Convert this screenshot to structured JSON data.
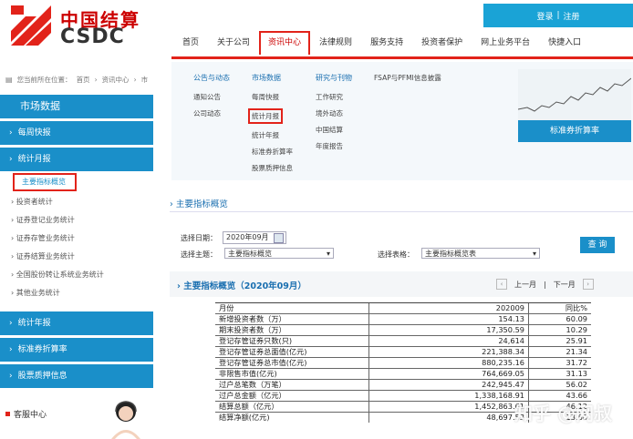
{
  "brand": {
    "name_cn": "中国结算",
    "name_en": "CSDC",
    "accent": "#e2231a",
    "blue": "#1a8fc9"
  },
  "header": {
    "login": "登录",
    "sep": "|",
    "register": "注册"
  },
  "topnav": [
    "首页",
    "关于公司",
    "资讯中心",
    "法律规则",
    "服务支持",
    "投资者保护",
    "网上业务平台",
    "快捷入口"
  ],
  "breadcrumb": {
    "prefix": "您当前所在位置：",
    "items": [
      "首页",
      "资讯中心",
      "市"
    ]
  },
  "sidebar": {
    "title": "市场数据",
    "weekly": "每周快报",
    "monthly": "统计月报",
    "subs": [
      "主要指标概览",
      "投资者统计",
      "证券登记业务统计",
      "证券存管业务统计",
      "证券结算业务统计",
      "全国股份转让系统业务统计",
      "其他业务统计"
    ],
    "annual": "统计年报",
    "index": "标准券折算率",
    "pledge": "股票质押信息",
    "service": "客服中心"
  },
  "dropdown": {
    "col1": {
      "head": "公告与动态",
      "items": [
        "通知公告",
        "公司动态"
      ]
    },
    "col2": {
      "head": "市场数据",
      "items": [
        "每周快报",
        "统计月报",
        "统计年报",
        "标准券折算率",
        "股票质押信息"
      ]
    },
    "col3": {
      "head": "研究与刊物",
      "items": [
        "工作研究",
        "境外动态",
        "中国结算",
        "年度报告"
      ]
    },
    "fsap": "FSAP与PFMI信息披露",
    "promo": "标准券折算率"
  },
  "main": {
    "section1": "主要指标概览",
    "date_label": "选择日期：",
    "date_value": "2020年09月",
    "theme_label": "选择主题：",
    "theme_value": "主要指标概览",
    "table_label": "选择表格：",
    "table_value": "主要指标概览表",
    "query": "查 询",
    "section2": "主要指标概览（2020年09月）",
    "prev": "上一月",
    "next": "下一月",
    "prev_arrow": "‹",
    "next_arrow": "›",
    "bar": "|"
  },
  "table": {
    "headers": [
      "月份",
      "202009",
      "同比%"
    ],
    "rows": [
      [
        "新增投资者数（万）",
        "154.13",
        "60.09"
      ],
      [
        "期末投资者数（万）",
        "17,350.59",
        "10.29"
      ],
      [
        "登记存管证券只数(只)",
        "24,614",
        "25.91"
      ],
      [
        "登记存管证券总面值(亿元)",
        "221,388.34",
        "21.34"
      ],
      [
        "登记存管证券总市值(亿元)",
        "880,235.16",
        "31.72"
      ],
      [
        "非限售市值(亿元)",
        "764,669.05",
        "31.13"
      ],
      [
        "过户总笔数（万笔）",
        "242,945.47",
        "56.02"
      ],
      [
        "过户总金额（亿元）",
        "1,338,168.91",
        "43.66"
      ],
      [
        "结算总额（亿元）",
        "1,452,863.61",
        "46.12"
      ],
      [
        "结算净额(亿元)",
        "48,697.53",
        "13.60"
      ]
    ]
  },
  "watermark": "知乎 @网叔"
}
